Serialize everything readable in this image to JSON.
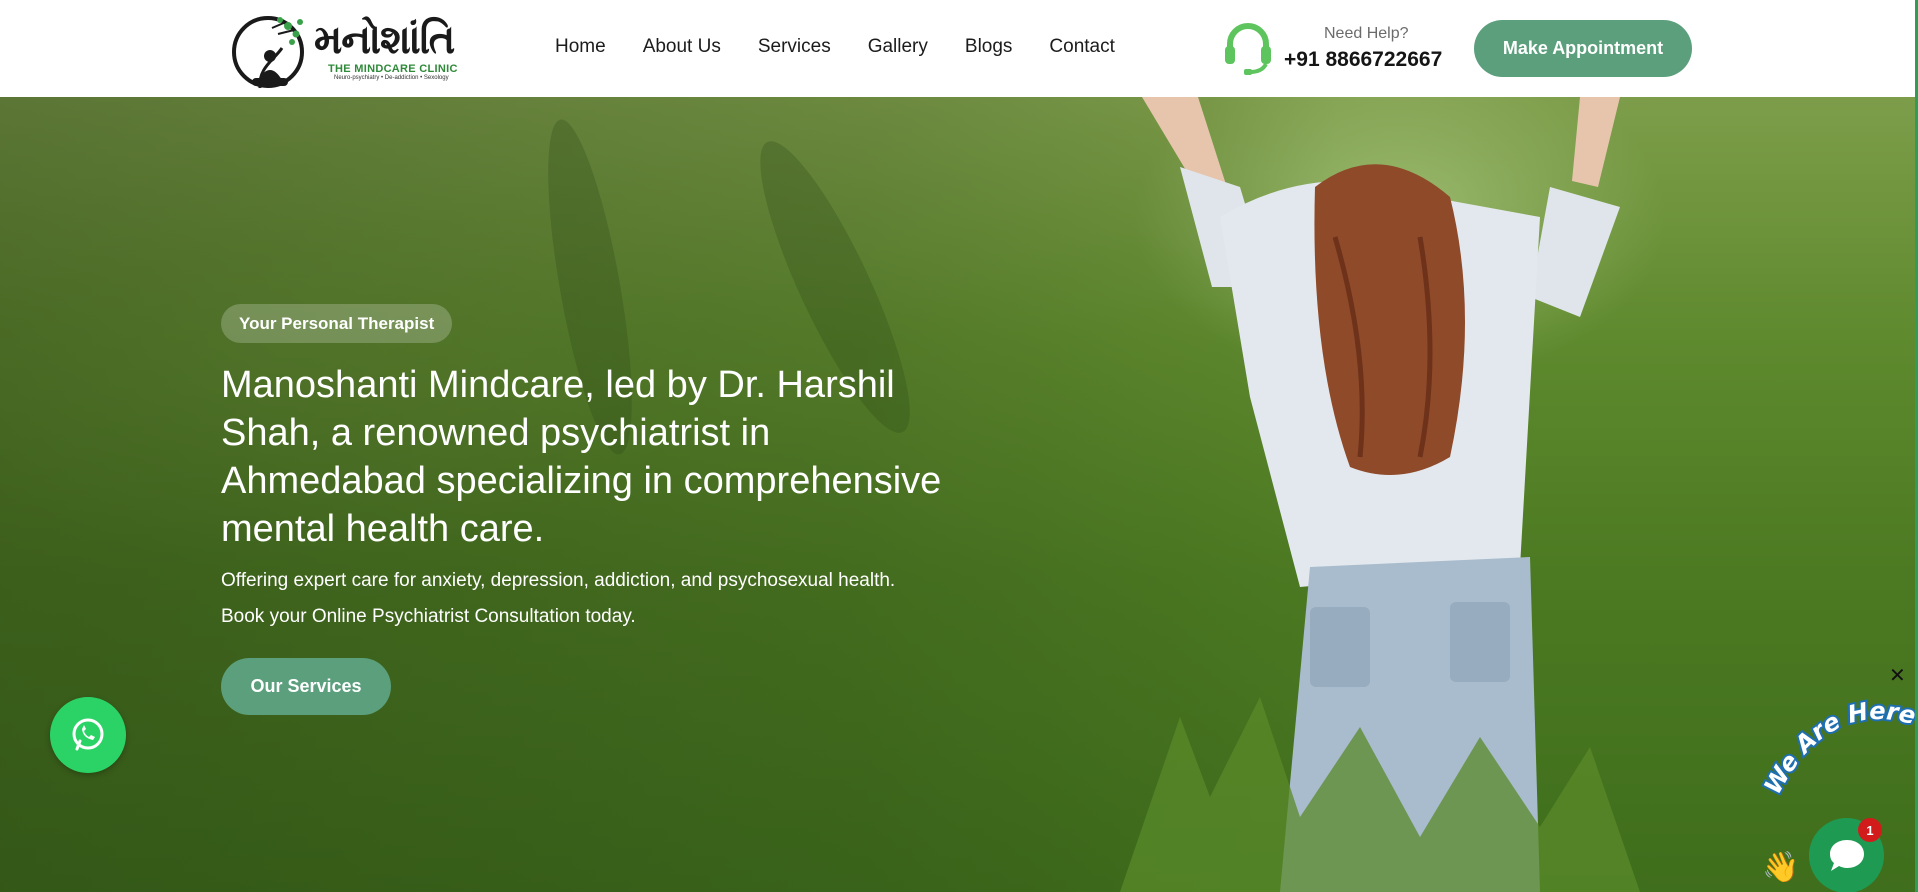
{
  "brand": {
    "logo_text": "મનોશાંતિ",
    "logo_subtitle": "THE MINDCARE CLINIC",
    "logo_tagline": "Neuro-psychiatry • De-addiction • Sexology"
  },
  "nav": {
    "items": [
      {
        "label": "Home"
      },
      {
        "label": "About Us"
      },
      {
        "label": "Services"
      },
      {
        "label": "Gallery"
      },
      {
        "label": "Blogs"
      },
      {
        "label": "Contact"
      }
    ]
  },
  "help": {
    "label": "Need Help?",
    "phone": "+91 8866722667"
  },
  "header_cta": {
    "label": "Make Appointment"
  },
  "hero": {
    "badge": "Your Personal Therapist",
    "headline": "Manoshanti Mindcare, led by Dr. Harshil Shah, a renowned psychiatrist in Ahmedabad specializing in comprehensive mental health care.",
    "sub_line_1": "Offering expert care for anxiety, depression, addiction, and psychosexual health.",
    "sub_line_2": "Book your Online Psychiatrist Consultation today.",
    "cta_label": "Our Services"
  },
  "chat_widget": {
    "banner_text": "We Are Here!",
    "unread_count": "1",
    "close_glyph": "✕"
  },
  "colors": {
    "accent": "#5b9f7c",
    "whatsapp": "#2bd366",
    "chat": "#1f9a52",
    "badge_red": "#d21b1b"
  },
  "icons": {
    "whatsapp": "whatsapp-icon",
    "headset": "headset-icon",
    "chat": "chat-icon",
    "close": "close-icon",
    "wave": "waving-hand-icon"
  }
}
